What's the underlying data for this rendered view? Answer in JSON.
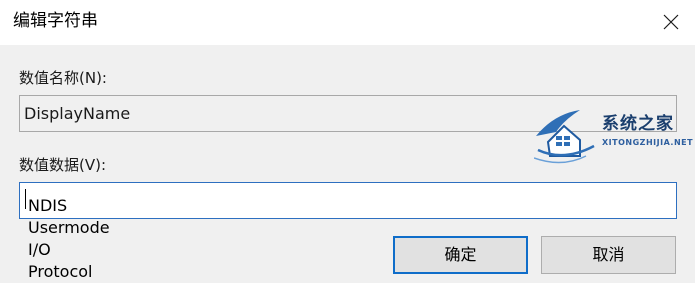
{
  "dialog": {
    "title": "编辑字符串",
    "close_icon": "close-icon"
  },
  "value_name": {
    "label": "数值名称(N):",
    "value": "DisplayName"
  },
  "value_data": {
    "label": "数值数据(V):",
    "value": "NDIS Usermode I/O Protocol"
  },
  "buttons": {
    "ok": "确定",
    "cancel": "取消"
  },
  "watermark": {
    "name": "系统之家",
    "url": "XITONGZHIJIA.NET",
    "icon": "house-logo-icon"
  },
  "colors": {
    "accent": "#0f6dc9",
    "input_border": "#2d6fc0",
    "dialog_bg": "#f0f0f0"
  }
}
